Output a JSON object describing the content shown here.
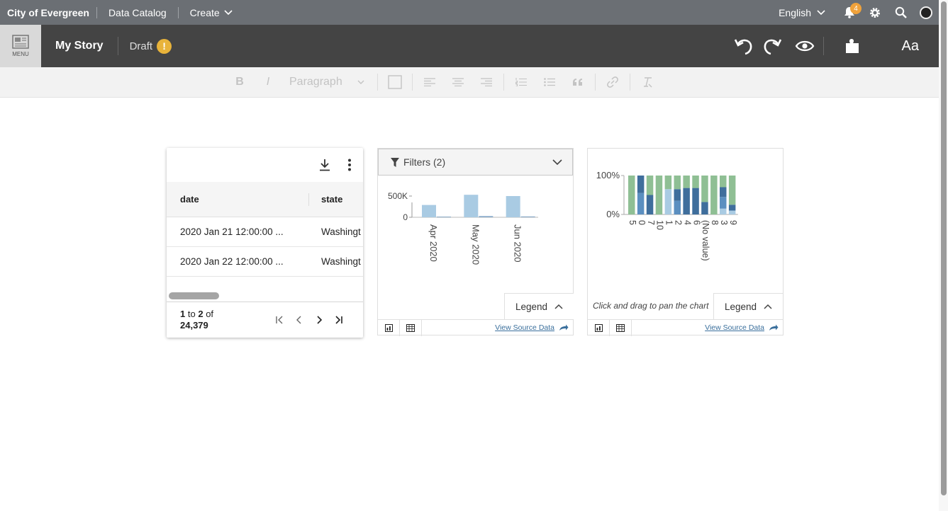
{
  "topbar": {
    "site_name": "City of Evergreen",
    "nav": {
      "data_catalog": "Data Catalog",
      "create": "Create"
    },
    "language": "English",
    "notifications_count": "4"
  },
  "story": {
    "menu_label": "MENU",
    "title": "My Story",
    "status": "Draft",
    "status_icon": "!",
    "typography_label": "Aa"
  },
  "format_toolbar": {
    "bold": "B",
    "italic": "I",
    "block_style": "Paragraph"
  },
  "table": {
    "columns": [
      "date",
      "state"
    ],
    "rows": [
      {
        "date": "2020 Jan 21 12:00:00 ...",
        "state": "Washingt"
      },
      {
        "date": "2020 Jan 22 12:00:00 ...",
        "state": "Washingt"
      }
    ],
    "pagination": {
      "start": "1",
      "to": "to",
      "end": "2",
      "of": "of",
      "total": "24,379"
    }
  },
  "viz1": {
    "filters_label": "Filters (2)",
    "legend_label": "Legend",
    "view_source_label": "View Source Data",
    "chart_data": {
      "type": "bar",
      "categories": [
        "Apr 2020",
        "May 2020",
        "Jun 2020"
      ],
      "series": [
        {
          "values": [
            290000,
            530000,
            500000
          ]
        },
        {
          "values": [
            15000,
            30000,
            20000
          ]
        }
      ],
      "yticks": [
        "500K",
        "0"
      ],
      "ylim": [
        0,
        650000
      ],
      "colors": [
        "#a9cbe3",
        "#4f86b5"
      ]
    }
  },
  "viz2": {
    "legend_label": "Legend",
    "view_source_label": "View Source Data",
    "hint": "Click and drag to pan the chart",
    "chart_data": {
      "type": "bar",
      "stacked": true,
      "percent": true,
      "categories": [
        "5",
        "0",
        "7",
        "10",
        "1",
        "2",
        "4",
        "6",
        "(No value)",
        "8",
        "3",
        "9"
      ],
      "yticks": [
        "100%",
        "0%"
      ],
      "segments": [
        [
          [
            0.0,
            "#8fbf94"
          ]
        ],
        [
          [
            0.55,
            "#5b8fc0"
          ],
          [
            0.45,
            "#3f6e9c"
          ]
        ],
        [
          [
            0.5,
            "#3f6e9c"
          ],
          [
            0.5,
            "#8fbf94"
          ]
        ],
        [
          [
            1.0,
            "#8fbf94"
          ]
        ],
        [
          [
            0.65,
            "#a9cbe3"
          ],
          [
            0.35,
            "#8fbf94"
          ]
        ],
        [
          [
            0.35,
            "#5b8fc0"
          ],
          [
            0.3,
            "#3f6e9c"
          ],
          [
            0.35,
            "#8fbf94"
          ]
        ],
        [
          [
            0.68,
            "#3f6e9c"
          ],
          [
            0.32,
            "#8fbf94"
          ]
        ],
        [
          [
            0.68,
            "#3f6e9c"
          ],
          [
            0.32,
            "#8fbf94"
          ]
        ],
        [
          [
            0.32,
            "#3f6e9c"
          ],
          [
            0.68,
            "#8fbf94"
          ]
        ],
        [
          [
            1.0,
            "#8fbf94"
          ]
        ],
        [
          [
            0.15,
            "#a9cbe3"
          ],
          [
            0.3,
            "#5b8fc0"
          ],
          [
            0.25,
            "#3f6e9c"
          ],
          [
            0.3,
            "#8fbf94"
          ]
        ],
        [
          [
            0.1,
            "#a9cbe3"
          ],
          [
            0.15,
            "#3f6e9c"
          ],
          [
            0.75,
            "#8fbf94"
          ]
        ]
      ]
    }
  }
}
